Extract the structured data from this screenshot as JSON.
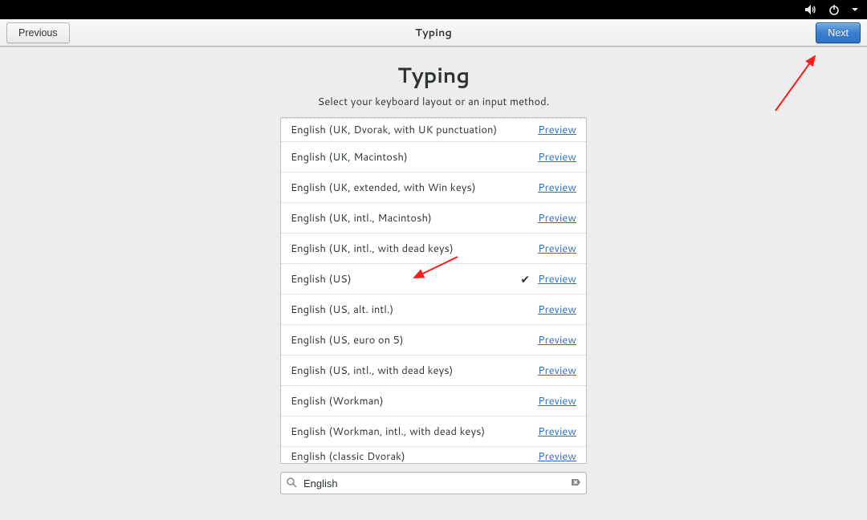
{
  "header": {
    "title": "Typing",
    "previous_label": "Previous",
    "next_label": "Next"
  },
  "page": {
    "title": "Typing",
    "subtitle": "Select your keyboard layout or an input method."
  },
  "preview_label": "Preview",
  "selected_index": 5,
  "layouts": [
    {
      "name": "English (UK, Dvorak, with UK punctuation)"
    },
    {
      "name": "English (UK, Macintosh)"
    },
    {
      "name": "English (UK, extended, with Win keys)"
    },
    {
      "name": "English (UK, intl., Macintosh)"
    },
    {
      "name": "English (UK, intl., with dead keys)"
    },
    {
      "name": "English (US)"
    },
    {
      "name": "English (US, alt. intl.)"
    },
    {
      "name": "English (US, euro on 5)"
    },
    {
      "name": "English (US, intl., with dead keys)"
    },
    {
      "name": "English (Workman)"
    },
    {
      "name": "English (Workman, intl., with dead keys)"
    },
    {
      "name": "English (classic Dvorak)"
    }
  ],
  "search": {
    "value": "English",
    "placeholder": ""
  }
}
